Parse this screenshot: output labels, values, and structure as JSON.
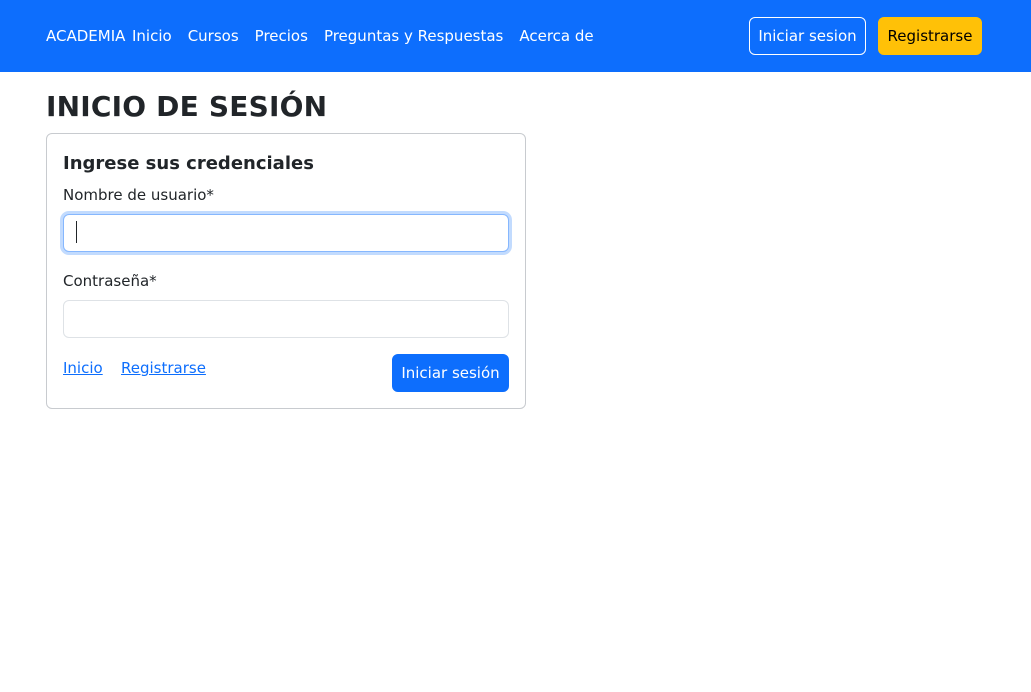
{
  "navbar": {
    "brand": "ACADEMIA",
    "links": [
      "Inicio",
      "Cursos",
      "Precios",
      "Preguntas y Respuestas",
      "Acerca de"
    ],
    "login_button": "Iniciar sesion",
    "register_button": "Registrarse",
    "background_color": "#0d6efd",
    "register_color": "#ffc107"
  },
  "main": {
    "title": "INICIO DE SESIÓN",
    "card": {
      "title": "Ingrese sus credenciales",
      "username_label": "Nombre de usuario*",
      "username_value": "",
      "password_label": "Contraseña*",
      "password_value": "",
      "link_home": "Inicio",
      "link_register": "Registrarse",
      "submit_button": "Iniciar sesión"
    }
  }
}
